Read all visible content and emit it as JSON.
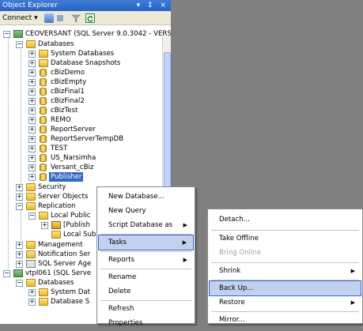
{
  "panel": {
    "title": "Object Explorer",
    "title_icons": "▾ ↕ ×"
  },
  "toolbar": {
    "connect_label": "Connect ▾"
  },
  "tree": {
    "server": "CEOVERSANT (SQL Server 9.0.3042 - VERS",
    "databases": "Databases",
    "system_databases": "System Databases",
    "database_snapshots": "Database Snapshots",
    "dbs": [
      "cBizDemo",
      "cBizEmpty",
      "cBizFinal1",
      "cBizFinal2",
      "cBizTest",
      "REMO",
      "ReportServer",
      "ReportServerTempDB",
      "TEST",
      "US_Narsimha",
      "Versant_cBiz",
      "Publisher"
    ],
    "security": "Security",
    "server_objects": "Server Objects",
    "replication": "Replication",
    "local_publications": "Local Public",
    "publisher_pub": "[Publish",
    "local_subscriptions": "Local Subsc",
    "management": "Management",
    "notification": "Notification Ser",
    "agent": "SQL Server Age",
    "server2": "vtpl061 (SQL Serve",
    "databases2": "Databases",
    "system_databases2": "System Dat",
    "database_snapshots2": "Database S"
  },
  "context_menu": {
    "items": [
      "New Database...",
      "New Query",
      "Script Database as",
      "Tasks",
      "Reports",
      "Rename",
      "Delete",
      "Refresh",
      "Properties"
    ]
  },
  "tasks_menu": {
    "items": [
      "Detach...",
      "Take Offline",
      "Bring Online",
      "Shrink",
      "Back Up...",
      "Restore",
      "Mirror..."
    ]
  }
}
